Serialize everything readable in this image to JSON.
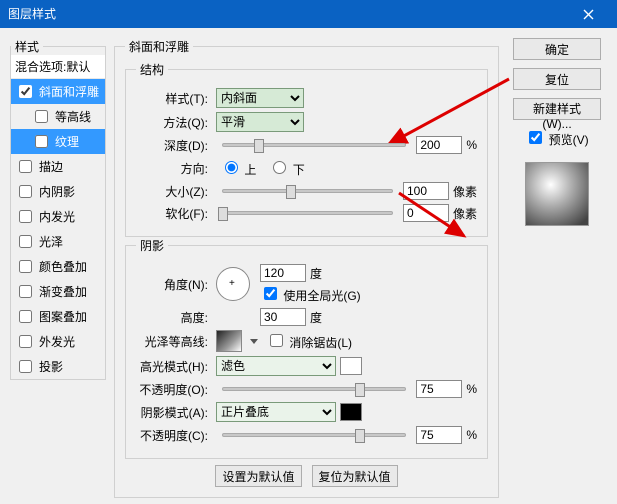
{
  "window": {
    "title": "图层样式"
  },
  "left": {
    "legend": "样式",
    "blend_default": "混合选项:默认",
    "items": [
      {
        "label": "斜面和浮雕",
        "checked": true,
        "selected": true
      },
      {
        "label": "等高线",
        "checked": false,
        "child": true
      },
      {
        "label": "纹理",
        "checked": false,
        "child": true,
        "selected": true
      },
      {
        "label": "描边",
        "checked": false
      },
      {
        "label": "内阴影",
        "checked": false
      },
      {
        "label": "内发光",
        "checked": false
      },
      {
        "label": "光泽",
        "checked": false
      },
      {
        "label": "颜色叠加",
        "checked": false
      },
      {
        "label": "渐变叠加",
        "checked": false
      },
      {
        "label": "图案叠加",
        "checked": false
      },
      {
        "label": "外发光",
        "checked": false
      },
      {
        "label": "投影",
        "checked": false
      }
    ]
  },
  "mid": {
    "legend": "斜面和浮雕",
    "struct_legend": "结构",
    "style_label": "样式(T):",
    "style_value": "内斜面",
    "method_label": "方法(Q):",
    "method_value": "平滑",
    "depth_label": "深度(D):",
    "depth_value": "200",
    "pct": "%",
    "dir_label": "方向:",
    "dir_up": "上",
    "dir_down": "下",
    "size_label": "大小(Z):",
    "size_value": "100",
    "px": "像素",
    "soften_label": "软化(F):",
    "soften_value": "0",
    "shadow_legend": "阴影",
    "angle_label": "角度(N):",
    "angle_value": "120",
    "deg": "度",
    "global_label": "使用全局光(G)",
    "altitude_label": "高度:",
    "altitude_value": "30",
    "gloss_label": "光泽等高线:",
    "antialias_label": "消除锯齿(L)",
    "hlmode_label": "高光模式(H):",
    "hlmode_value": "滤色",
    "hl_opacity_label": "不透明度(O):",
    "hl_opacity_value": "75",
    "shmode_label": "阴影模式(A):",
    "shmode_value": "正片叠底",
    "sh_opacity_label": "不透明度(C):",
    "sh_opacity_value": "75",
    "set_default": "设置为默认值",
    "reset_default": "复位为默认值"
  },
  "right": {
    "ok": "确定",
    "cancel": "复位",
    "newstyle": "新建样式(W)...",
    "preview_label": "预览(V)"
  }
}
